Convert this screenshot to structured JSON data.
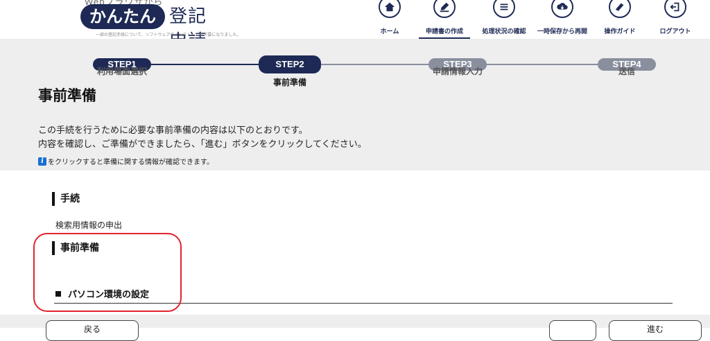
{
  "header": {
    "logo_sub": "Webブラウザから",
    "logo_highlight": "かんたん",
    "logo_main": "登記申請",
    "logo_note": "一部の登記手続について、ソフトウェアのインストールが不要になりました。",
    "nav": [
      {
        "label": "ホーム",
        "icon": "home-icon"
      },
      {
        "label": "申請書の作成",
        "icon": "edit-icon",
        "active": true
      },
      {
        "label": "処理状況の確認",
        "icon": "list-icon"
      },
      {
        "label": "一時保存から再開",
        "icon": "cloud-download-icon"
      },
      {
        "label": "操作ガイド",
        "icon": "book-icon"
      },
      {
        "label": "ログアウト",
        "icon": "logout-icon"
      }
    ]
  },
  "stepper": [
    {
      "badge": "STEP1",
      "label": "利用場面選択",
      "state": "done"
    },
    {
      "badge": "STEP2",
      "label": "事前準備",
      "state": "current"
    },
    {
      "badge": "STEP3",
      "label": "申請情報入力",
      "state": "todo"
    },
    {
      "badge": "STEP4",
      "label": "送信",
      "state": "todo"
    }
  ],
  "page": {
    "title": "事前準備",
    "desc_line1": "この手続を行うために必要な事前準備の内容は以下のとおりです。",
    "desc_line2": "内容を確認し、ご準備ができましたら、「進む」ボタンをクリックしてください。",
    "info_note": "をクリックすると準備に関する情報が確認できます。",
    "info_icon": "i"
  },
  "procedure": {
    "heading": "手続",
    "name": "検索用情報の申出"
  },
  "preparation": {
    "heading": "事前準備",
    "subsection": "パソコン環境の設定"
  },
  "footer": {
    "back_label": "戻る",
    "save_label": "",
    "next_label": "進む"
  },
  "colors": {
    "brand": "#1e2a55",
    "step_todo": "#8a8f9e",
    "band": "#eeeeee",
    "highlight": "#e0242f"
  }
}
